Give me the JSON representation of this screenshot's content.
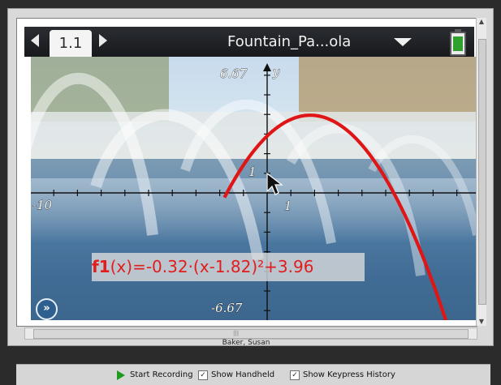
{
  "window": {
    "tab_label": "1.1",
    "document_title": "Fountain_Pa...ola",
    "author": "Baker, Susan"
  },
  "graph": {
    "x_min_label": "-10",
    "x_one_label": "1",
    "y_max_label": "6.67",
    "y_one_label": "1",
    "y_min_label": "-6.67",
    "axis_y_name": "y",
    "function_name": "f1",
    "function_expression": "(x)=-0.32·(x-1.82)²+3.96",
    "curve_color": "#e01616"
  },
  "controls": {
    "record_label": "Start Recording",
    "show_handheld_label": "Show Handheld",
    "show_keypress_label": "Show Keypress History"
  }
}
